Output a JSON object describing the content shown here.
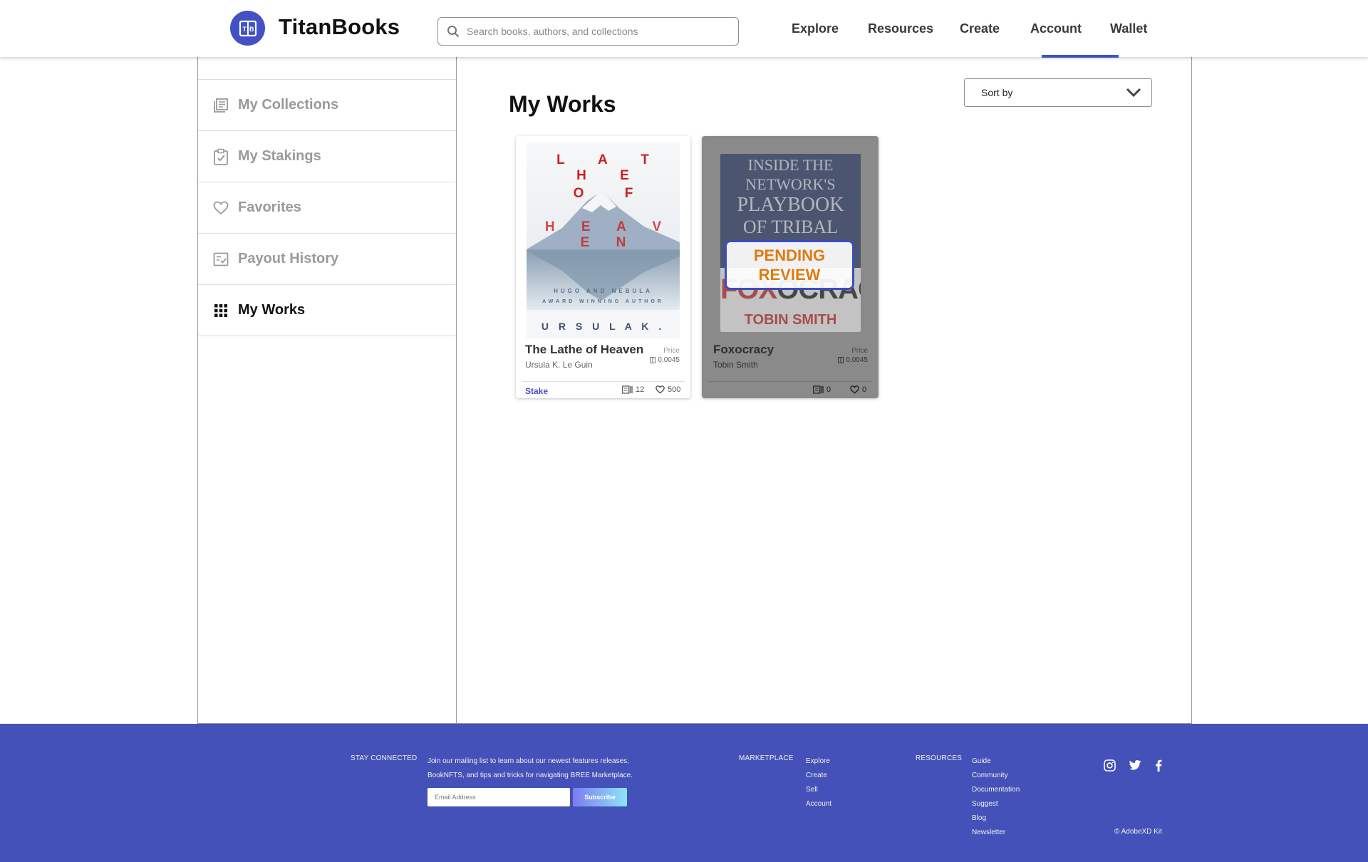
{
  "header": {
    "brand": "TitanBooks",
    "search_placeholder": "Search books, authors, and collections",
    "nav": [
      "Explore",
      "Resources",
      "Create",
      "Account",
      "Wallet"
    ],
    "active_nav": "Account"
  },
  "sidebar": {
    "items": [
      {
        "label": "My Collections",
        "icon": "collections-icon"
      },
      {
        "label": "My Stakings",
        "icon": "clipboard-check-icon"
      },
      {
        "label": "Favorites",
        "icon": "heart-icon"
      },
      {
        "label": "Payout History",
        "icon": "history-icon"
      },
      {
        "label": "My Works",
        "icon": "grid-icon",
        "active": true
      }
    ]
  },
  "main": {
    "title": "My Works",
    "sort_label": "Sort by",
    "cards": [
      {
        "title": "The Lathe of Heaven",
        "author": "Ursula K. Le Guin",
        "price_label": "Price",
        "price": "0.0045",
        "action": "Stake",
        "copies": "12",
        "likes": "500",
        "cover": {
          "title_letters": [
            "L A T H E",
            "O F",
            "H E A V E N"
          ],
          "tagline": [
            "HUGO AND NEBULA",
            "AWARD WINNING AUTHOR"
          ],
          "author_line": "U R S U L A   K ."
        }
      },
      {
        "title": "Foxocracy",
        "author": "Tobin Smith",
        "price_label": "Price",
        "price": "0.0045",
        "copies": "0",
        "likes": "0",
        "status": [
          "PENDING",
          "REVIEW"
        ],
        "cover": {
          "headline": [
            "INSIDE THE",
            "NETWORK'S",
            "PLAYBOOK",
            "OF TRIBAL"
          ],
          "big_title_red": "FOX",
          "big_title_black": "OCRACY",
          "author_line": "TOBIN SMITH"
        }
      }
    ]
  },
  "footer": {
    "stay_connected": "STAY CONNECTED",
    "mailing_text": "Join our mailing list to learn about our newest features releases, BookNFTS, and tips and tricks for navigating BREE Marketplace.",
    "email_placeholder": "Email Address",
    "subscribe": "Subscribe",
    "marketplace_head": "MARKETPLACE",
    "marketplace_links": [
      "Explore",
      "Create",
      "Sell",
      "Account"
    ],
    "resources_head": "RESOURCES",
    "resources_links": [
      "Guide",
      "Community",
      "Documentation",
      "Suggest",
      "Blog",
      "Newsletter"
    ],
    "social": [
      "instagram-icon",
      "twitter-icon",
      "facebook-icon"
    ],
    "copyright": "© AdobeXD Kit"
  },
  "colors": {
    "accent": "#4351c4",
    "footer_bg": "#4351b8",
    "pending_text": "#e07a10"
  }
}
